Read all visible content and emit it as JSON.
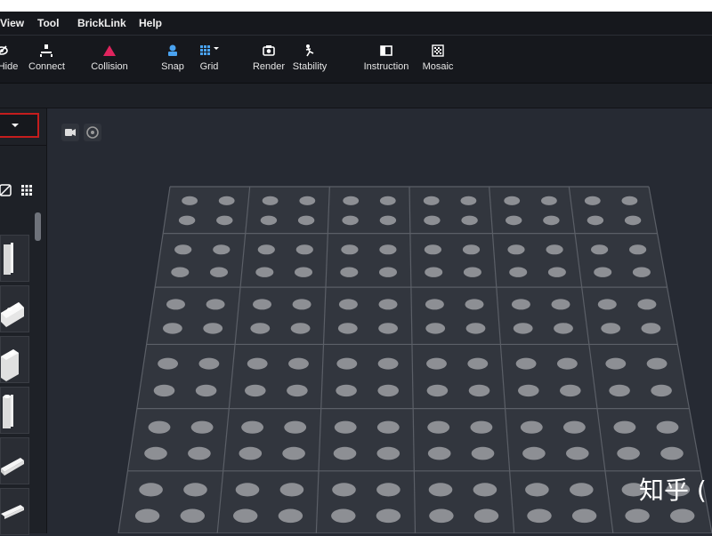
{
  "menu": [
    "View",
    "Tool",
    "BrickLink",
    "Help"
  ],
  "toolbar": {
    "items": [
      {
        "label": "Hide",
        "icon": "eye-slash-icon"
      },
      {
        "label": "Connect",
        "icon": "connect-icon"
      },
      {
        "label": "Collision",
        "icon": "collision-triangle-icon"
      },
      {
        "label": "Snap",
        "icon": "snap-icon"
      },
      {
        "label": "Grid",
        "icon": "grid-icon"
      },
      {
        "label": "Render",
        "icon": "camera-icon"
      },
      {
        "label": "Stability",
        "icon": "stability-icon"
      },
      {
        "label": "Instruction",
        "icon": "book-icon"
      },
      {
        "label": "Mosaic",
        "icon": "mosaic-icon"
      }
    ]
  },
  "left_panel": {
    "dropdown_caret": "chevron-down-icon",
    "icons": [
      "color-filter-icon",
      "grid-view-icon"
    ]
  },
  "viewport": {
    "buttons": [
      "video-camera-icon",
      "reset-view-icon"
    ],
    "baseplate": {
      "columns": 6,
      "rows": 6,
      "studs_per_cell": 4
    }
  },
  "watermark": "知乎 ("
}
